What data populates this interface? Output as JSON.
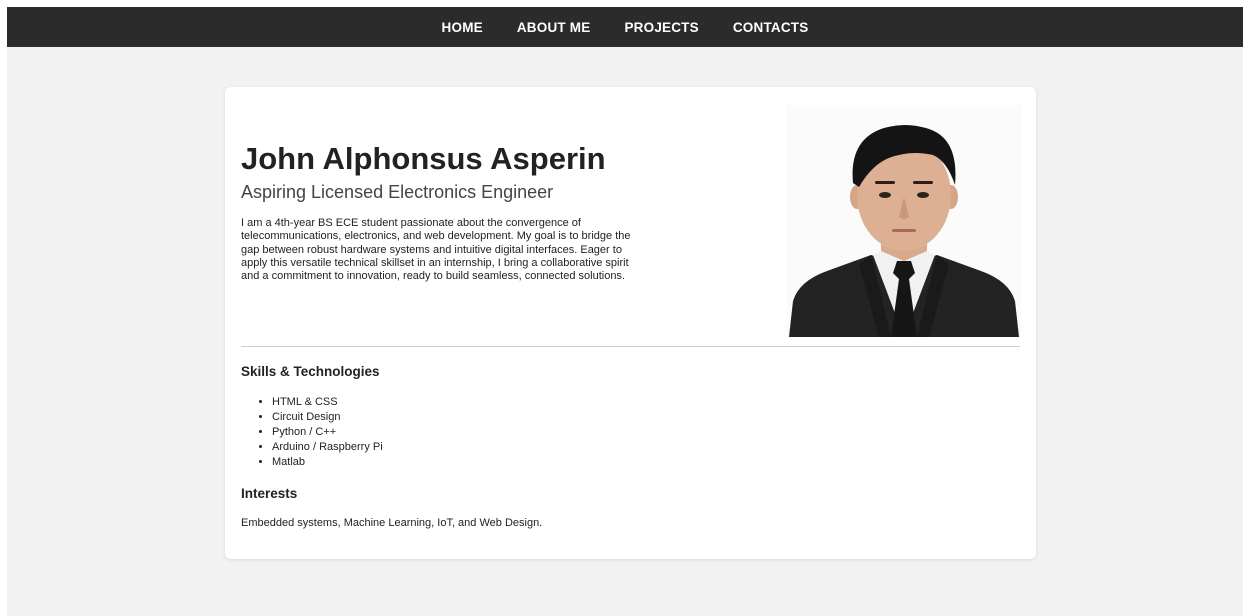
{
  "nav": {
    "items": [
      {
        "label": "HOME"
      },
      {
        "label": "ABOUT ME"
      },
      {
        "label": "PROJECTS"
      },
      {
        "label": "CONTACTS"
      }
    ]
  },
  "profile": {
    "name": "John Alphonsus Asperin",
    "subtitle": "Aspiring Licensed Electronics Engineer",
    "bio": "I am a 4th-year BS ECE student passionate about the convergence of telecommunications, electronics, and web development. My goal is to bridge the gap between robust hardware systems and intuitive digital interfaces. Eager to apply this versatile technical skillset in an internship, I bring a collaborative spirit and a commitment to innovation, ready to build seamless, connected solutions."
  },
  "skills": {
    "heading": "Skills & Technologies",
    "items": [
      "HTML & CSS",
      "Circuit Design",
      "Python / C++",
      "Arduino / Raspberry Pi",
      "Matlab"
    ]
  },
  "interests": {
    "heading": "Interests",
    "text": "Embedded systems, Machine Learning, IoT, and Web Design."
  },
  "colors": {
    "navbar": "#2b2b2b",
    "page_background": "#f2f2f2",
    "card_background": "#ffffff",
    "text": "#222222"
  }
}
